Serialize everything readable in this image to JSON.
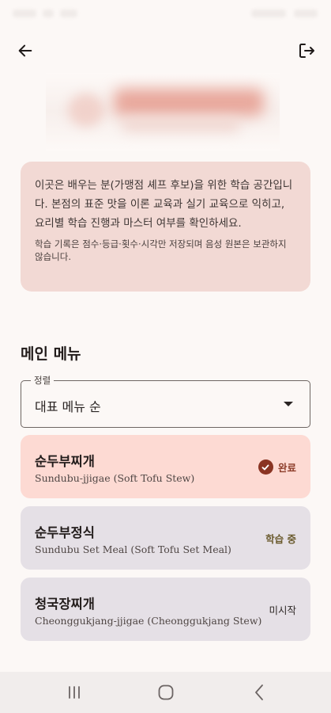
{
  "info": {
    "main_text": "이곳은 배우는 분(가맹점 셰프 후보)을 위한 학습 공간입니다. 본점의 표준 맛을 이론 교육과 실기 교육으로 익히고, 요리별 학습 진행과 마스터 여부를 확인하세요.",
    "sub_text": "학습 기록은 점수·등급·횟수·시각만 저장되며 음성 원본은 보관하지 않습니다."
  },
  "section_title": "메인 메뉴",
  "sort": {
    "label": "정렬",
    "value": "대표 메뉴 순"
  },
  "menu_items": [
    {
      "title": "순두부찌개",
      "subtitle": "Sundubu-jjigae (Soft Tofu Stew)",
      "status": "완료"
    },
    {
      "title": "순두부정식",
      "subtitle": "Sundubu Set Meal (Soft Tofu Set Meal)",
      "status": "학습 중"
    },
    {
      "title": "청국장찌개",
      "subtitle": "Cheonggukjang-jjigae (Cheonggukjang Stew)",
      "status": "미시작"
    }
  ],
  "icons": {
    "back": "arrow-left-icon",
    "logout": "logout-icon",
    "status_done": "check-circle-icon",
    "dropdown": "caret-down-icon",
    "nav_recents": "recents-icon",
    "nav_home": "home-icon",
    "nav_back": "chevron-left-icon"
  },
  "colors": {
    "background": "#fcf8f6",
    "info_card": "#f2d9d4",
    "item_done": "#fddad3",
    "item_pending": "#e5e0e6",
    "accent": "#8a3423"
  }
}
